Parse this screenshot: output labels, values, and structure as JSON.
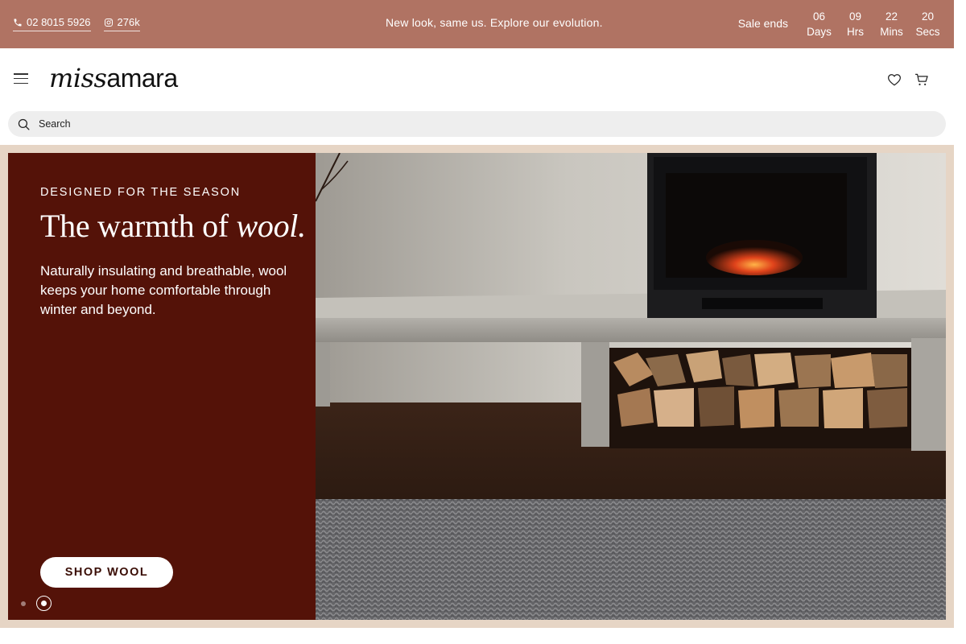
{
  "topbar": {
    "phone": "02 8015 5926",
    "instagram_count": "276k",
    "promo": "New look, same us. Explore our evolution.",
    "sale_label": "Sale ends",
    "countdown": [
      {
        "value": "06",
        "unit": "Days"
      },
      {
        "value": "09",
        "unit": "Hrs"
      },
      {
        "value": "22",
        "unit": "Mins"
      },
      {
        "value": "20",
        "unit": "Secs"
      }
    ],
    "bg_color": "#b07363"
  },
  "header": {
    "logo_part1": "miss",
    "logo_part2": "amara",
    "icons": [
      "menu-icon",
      "heart-icon",
      "cart-icon"
    ]
  },
  "search": {
    "placeholder": "Search"
  },
  "hero": {
    "eyebrow": "DESIGNED FOR THE SEASON",
    "headline_main": "The warmth of ",
    "headline_emphasis": "wool.",
    "body": "Naturally insulating and breathable, wool keeps your home comfortable through winter and beyond.",
    "cta": "SHOP WOOL",
    "panel_color": "#541208",
    "slides_total": 2,
    "active_slide": 2
  }
}
